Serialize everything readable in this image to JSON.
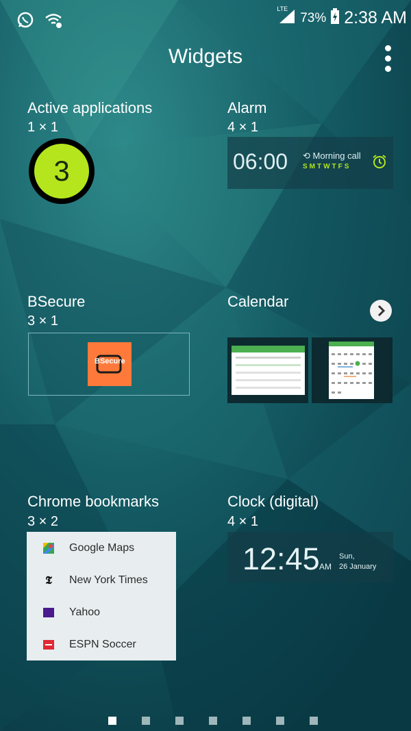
{
  "status_bar": {
    "network": "LTE",
    "battery": "73%",
    "time": "2:38 AM",
    "icons": [
      "whatsapp-icon",
      "wifi-icon",
      "signal-icon",
      "battery-charging-icon"
    ]
  },
  "header": {
    "title": "Widgets"
  },
  "widgets": [
    {
      "name": "Active applications",
      "size": "1 × 1",
      "preview": {
        "count": "3"
      }
    },
    {
      "name": "Alarm",
      "size": "4 × 1",
      "preview": {
        "time": "06:00",
        "label": "Morning call",
        "days": "SMTWTFS"
      }
    },
    {
      "name": "BSecure",
      "size": "3 × 1",
      "preview": {
        "logo_text": "BSecure"
      }
    },
    {
      "name": "Calendar",
      "size": ""
    },
    {
      "name": "Chrome bookmarks",
      "size": "3 × 2",
      "preview": {
        "items": [
          "Google Maps",
          "New York Times",
          "Yahoo",
          "ESPN Soccer"
        ]
      }
    },
    {
      "name": "Clock (digital)",
      "size": "4 × 1",
      "preview": {
        "time": "12:45",
        "ampm": "AM",
        "day": "Sun,",
        "date": "26 January"
      }
    }
  ],
  "pager": {
    "pages": 7,
    "current": 1
  },
  "colors": {
    "accent_green": "#b5e61d",
    "bsecure_orange": "#ff7a3a",
    "card_bg": "#e8eef0"
  }
}
